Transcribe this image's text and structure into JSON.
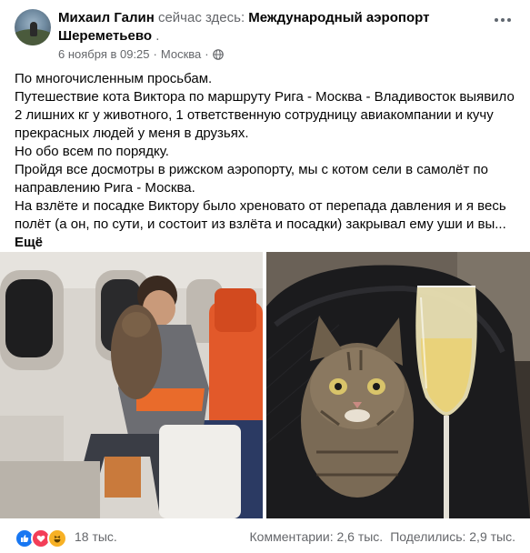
{
  "post": {
    "author": "Михаил Галин",
    "is_here": "сейчас здесь:",
    "place": "Международный аэропорт Шереметьево",
    "place_suffix": ".",
    "date": "6 ноября в 09:25",
    "sep": "·",
    "location": "Москва",
    "sep2": "·",
    "privacy_icon": "globe-icon",
    "more_icon": "more-options-icon",
    "paragraphs": [
      "По многочисленным просьбам.",
      "Путешествие кота Виктора по маршруту Рига - Москва - Владивосток выявило 2 лишних кг у животного, 1 ответственную сотрудницу авиакомпании и кучу прекрасных людей у меня в друзьях.",
      "Но обо всем по порядку.",
      "Пройдя все досмотры в рижском аэропорту, мы с котом сели в самолёт по направлению Рига - Москва.",
      "На взлёте и посадке Виктору было хреновато от перепада давления и я весь полёт (а он, по сути, и состоит из взлёта и посадки) закрывал ему уши и вы..."
    ],
    "see_more": "Ещё"
  },
  "footer": {
    "reaction_icons": [
      "like-icon",
      "love-icon",
      "haha-icon"
    ],
    "reactions_count": "18 тыс.",
    "comments": "Комментарии: 2,6 тыс.",
    "shares": "Поделились: 2,9 тыс."
  },
  "colors": {
    "text": "#050505",
    "secondary": "#65676b",
    "like": "#1877f2",
    "love": "#f33e58",
    "haha": "#f7b125"
  }
}
